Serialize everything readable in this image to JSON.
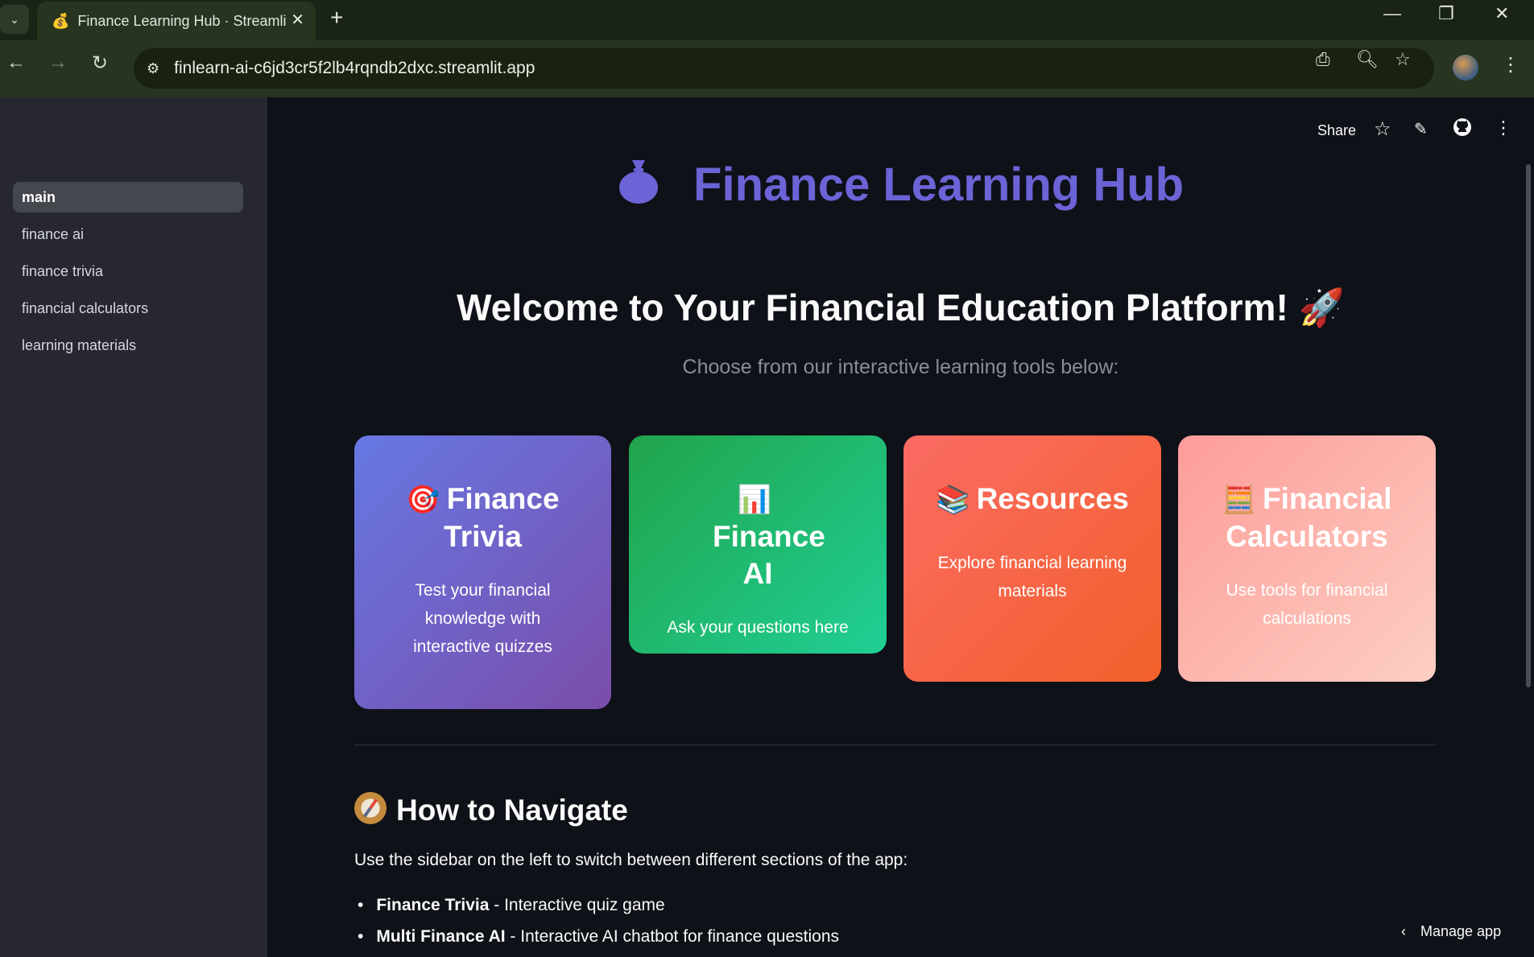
{
  "browser": {
    "tab_title": "Finance Learning Hub · Streamlit",
    "favicon": "money-bag-icon",
    "url": "finlearn-ai-c6jd3cr5f2lb4rqndb2dxc.streamlit.app",
    "new_tab": "+",
    "close_tab": "✕"
  },
  "sidebar": {
    "items": [
      {
        "label": "main",
        "active": true
      },
      {
        "label": "finance ai"
      },
      {
        "label": "finance trivia"
      },
      {
        "label": "financial calculators"
      },
      {
        "label": "learning materials"
      }
    ]
  },
  "header": {
    "share": "Share"
  },
  "hero": {
    "title": "Finance Learning Hub",
    "welcome": "Welcome to Your Financial Education Platform! 🚀",
    "subtitle": "Choose from our interactive learning tools below:"
  },
  "cards": [
    {
      "icon": "🎯",
      "title": "Finance Trivia",
      "desc": "Test your financial knowledge with interactive quizzes"
    },
    {
      "icon": "📊",
      "title": "Finance AI",
      "desc": "Ask your questions here"
    },
    {
      "icon": "📚",
      "title": "Resources",
      "desc": "Explore financial learning materials"
    },
    {
      "icon": "🧮",
      "title": "Financial Calculators",
      "desc": "Use tools for financial calculations"
    }
  ],
  "navigate": {
    "heading": "How to Navigate",
    "intro": "Use the sidebar on the left to switch between different sections of the app:",
    "bullets": [
      {
        "bold": "Finance Trivia",
        "rest": " - Interactive quiz game"
      },
      {
        "bold": "Multi Finance AI",
        "rest": " - Interactive AI chatbot for finance questions"
      }
    ]
  },
  "footer": {
    "manage_app": "Manage app"
  },
  "colors": {
    "accent": "#6c63d6",
    "background": "#0e1117",
    "sidebar": "#262730"
  }
}
